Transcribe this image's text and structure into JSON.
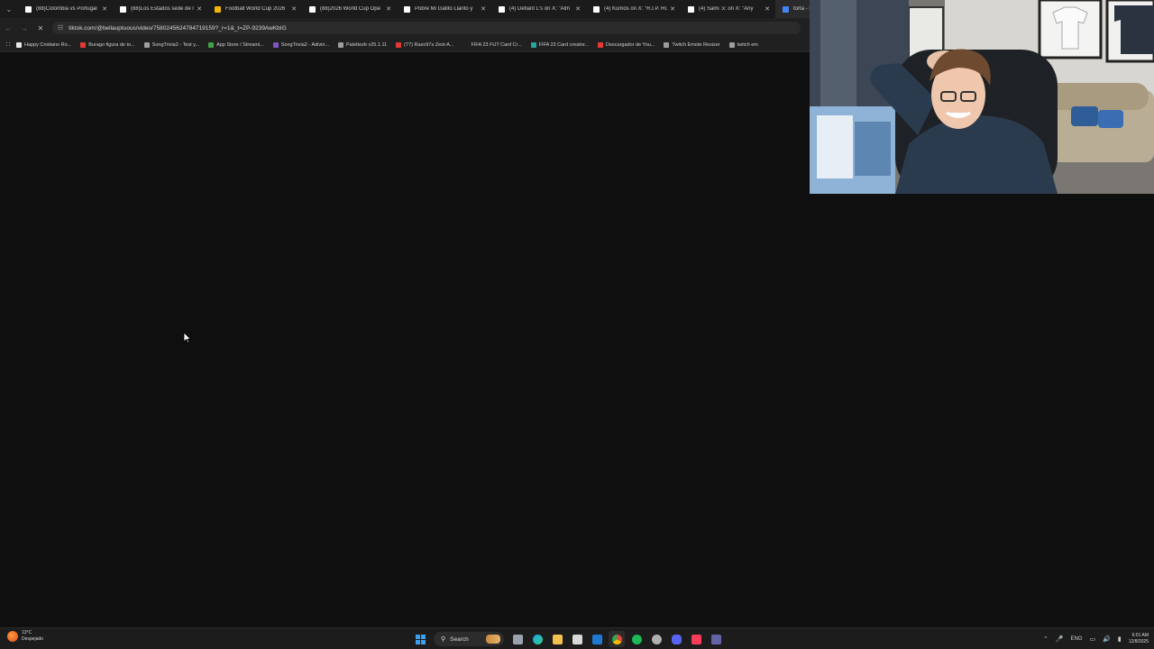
{
  "browser": {
    "tabs": [
      {
        "title": "(88)Colombia vs Portugal",
        "favicon_color": "#ffffff",
        "active": false
      },
      {
        "title": "(88)Los Estados sede de l",
        "favicon_color": "#ffffff",
        "active": false
      },
      {
        "title": "Football World Cup 2026",
        "favicon_color": "#f2b705",
        "active": false
      },
      {
        "title": "(88)2026 World Cup Ope",
        "favicon_color": "#ffffff",
        "active": false
      },
      {
        "title": "Pobre Mi Gatito Llanto y",
        "favicon_color": "#ffffff",
        "active": false
      },
      {
        "title": "(4) Defiant L's on X: \"Alm",
        "favicon_color": "#ffffff",
        "active": false
      },
      {
        "title": "(4) Kumos on X: \"R.I.P. RUI",
        "favicon_color": "#ffffff",
        "active": false
      },
      {
        "title": "(4) Sami :x: on X: \"Any",
        "favicon_color": "#ffffff",
        "active": false
      },
      {
        "title": "torta - Bu",
        "favicon_color": "#4285f4",
        "active": true
      }
    ],
    "address": "tiktok.com/@bellauptuous/video/7580245624784719159?_r=1&_t=ZP-9239AwKbIG",
    "bookmarks": [
      {
        "label": "Happy Cristiano Ro...",
        "color": "#e8e8e8"
      },
      {
        "label": "Burago figura de to...",
        "color": "#e53935"
      },
      {
        "label": "SongTrivia2 - Test y...",
        "color": "#9e9e9e"
      },
      {
        "label": "App Store / Streami...",
        "color": "#43a047"
      },
      {
        "label": "SongTrivia2 - Adivin...",
        "color": "#7e57c2"
      },
      {
        "label": "Palettezb v25.1.11",
        "color": "#9e9e9e"
      },
      {
        "label": "(77) Razo97s Zest-A...",
        "color": "#e53935"
      },
      {
        "label": "FIFA 23 FUT Card Cr...",
        "color": "#212121"
      },
      {
        "label": "FIFA 23 Card creator...",
        "color": "#26a69a"
      },
      {
        "label": "Descargador de You...",
        "color": "#e53935"
      },
      {
        "label": "Twitch Emote Resizer",
        "color": "#9e9e9e"
      },
      {
        "label": "twitch em",
        "color": "#9e9e9e"
      }
    ]
  },
  "taskbar": {
    "weather_temp": "13°C",
    "weather_desc": "Despejado",
    "search_label": "Search",
    "language": "ENG",
    "time": "6:01 AM",
    "date": "12/8/2025"
  }
}
